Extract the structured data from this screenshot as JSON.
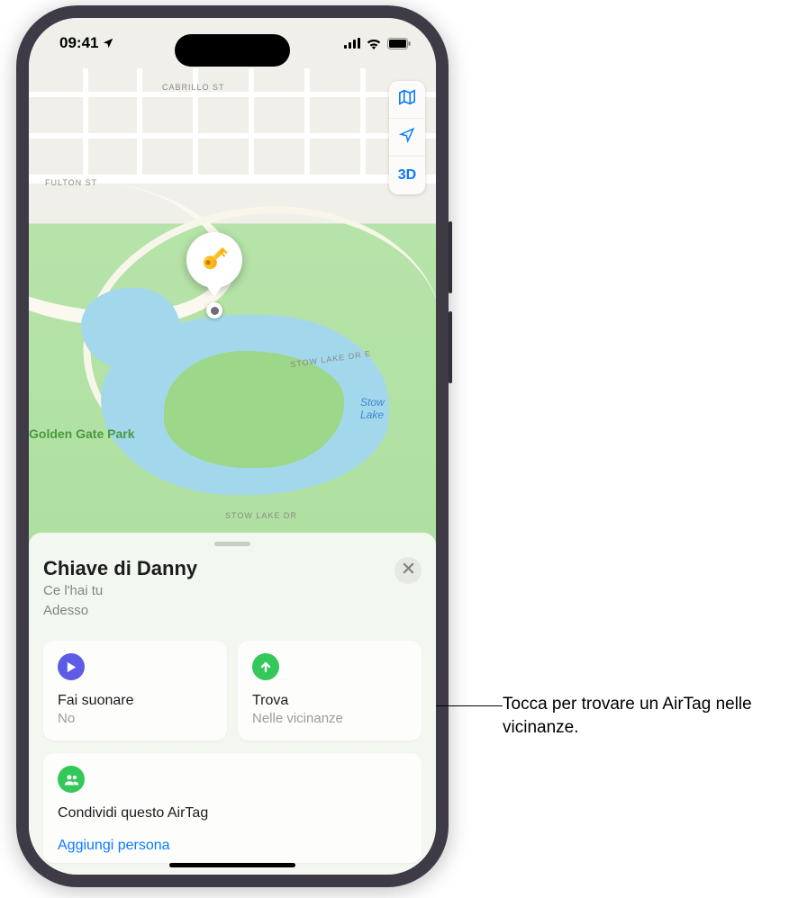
{
  "status_bar": {
    "time": "09:41"
  },
  "map": {
    "streets": {
      "cabrillo": "CABRILLO ST",
      "fulton": "FULTON ST",
      "stow_dr_e": "STOW LAKE DR E",
      "stow_dr": "STOW LAKE DR"
    },
    "park_label": "Golden Gate Park",
    "lake_label": "Stow\nLake",
    "controls": {
      "three_d": "3D"
    }
  },
  "sheet": {
    "title": "Chiave di Danny",
    "subtitle_line1": "Ce l'hai tu",
    "subtitle_line2": "Adesso",
    "tiles": {
      "play": {
        "title": "Fai suonare",
        "subtitle": "No"
      },
      "find": {
        "title": "Trova",
        "subtitle": "Nelle vicinanze"
      }
    },
    "share": {
      "title": "Condividi questo AirTag",
      "add_person": "Aggiungi persona"
    }
  },
  "callout": {
    "text": "Tocca per trovare un AirTag nelle vicinanze."
  },
  "colors": {
    "accent_blue": "#0a7aff",
    "play_icon": "#5e5ce6",
    "find_icon": "#34c759",
    "share_icon": "#34c759"
  }
}
